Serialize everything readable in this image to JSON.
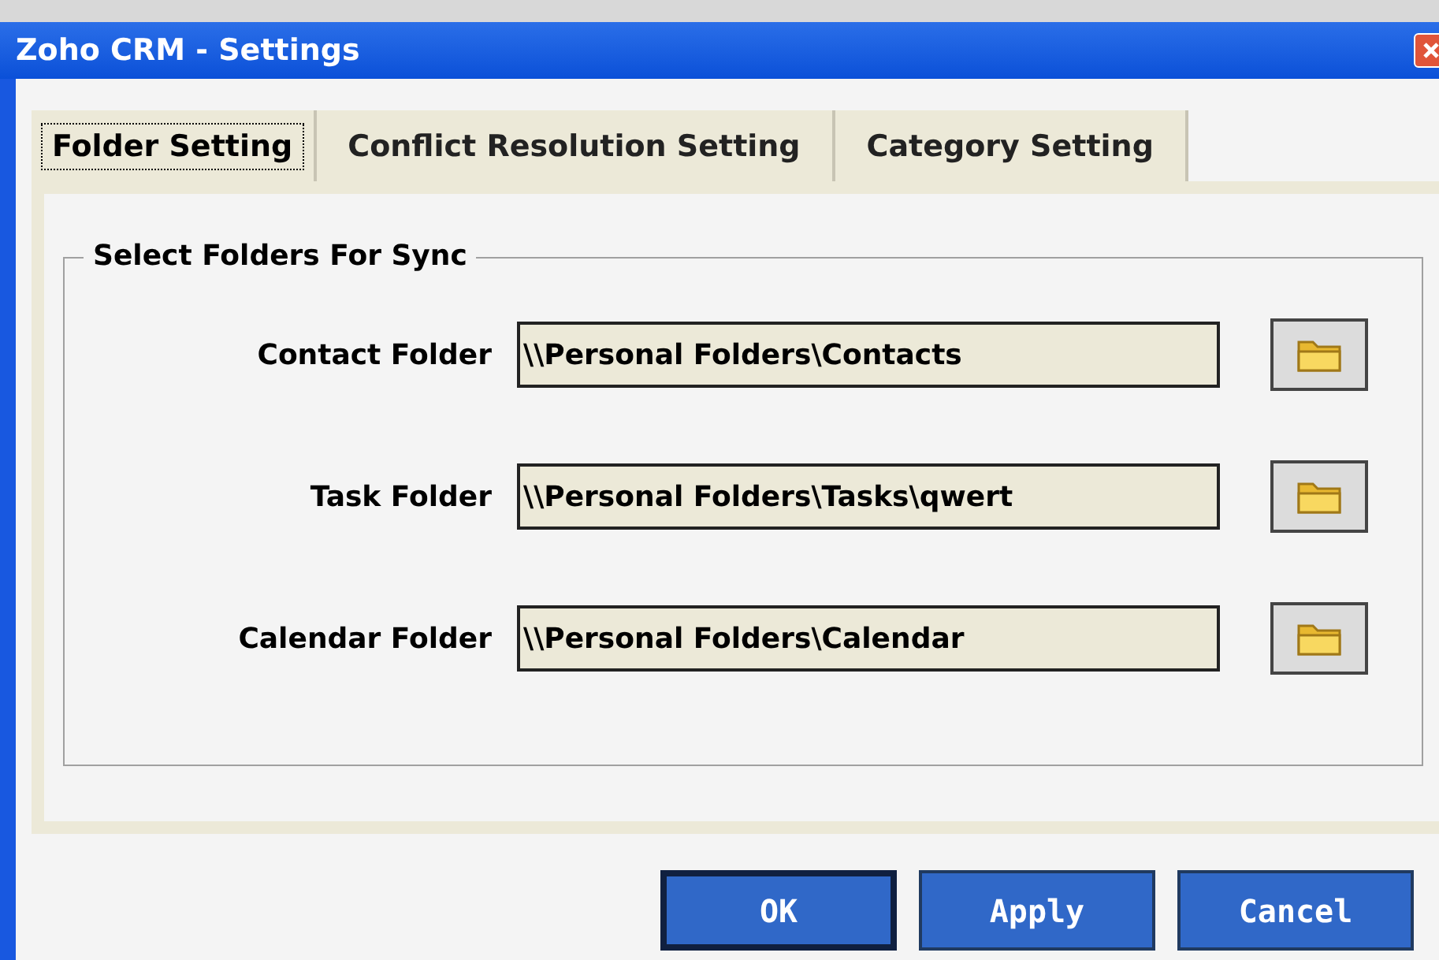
{
  "window": {
    "title": "Zoho CRM - Settings"
  },
  "tabs": [
    {
      "label": "Folder Setting",
      "selected": true
    },
    {
      "label": "Conflict Resolution Setting",
      "selected": false
    },
    {
      "label": "Category Setting",
      "selected": false
    }
  ],
  "group": {
    "title": "Select Folders For Sync"
  },
  "folders": [
    {
      "label": "Contact Folder",
      "value": "\\\\Personal Folders\\Contacts"
    },
    {
      "label": "Task Folder",
      "value": "\\\\Personal Folders\\Tasks\\qwert"
    },
    {
      "label": "Calendar Folder",
      "value": "\\\\Personal Folders\\Calendar"
    }
  ],
  "buttons": [
    {
      "label": "OK",
      "default": true
    },
    {
      "label": "Apply",
      "default": false
    },
    {
      "label": "Cancel",
      "default": false
    }
  ]
}
